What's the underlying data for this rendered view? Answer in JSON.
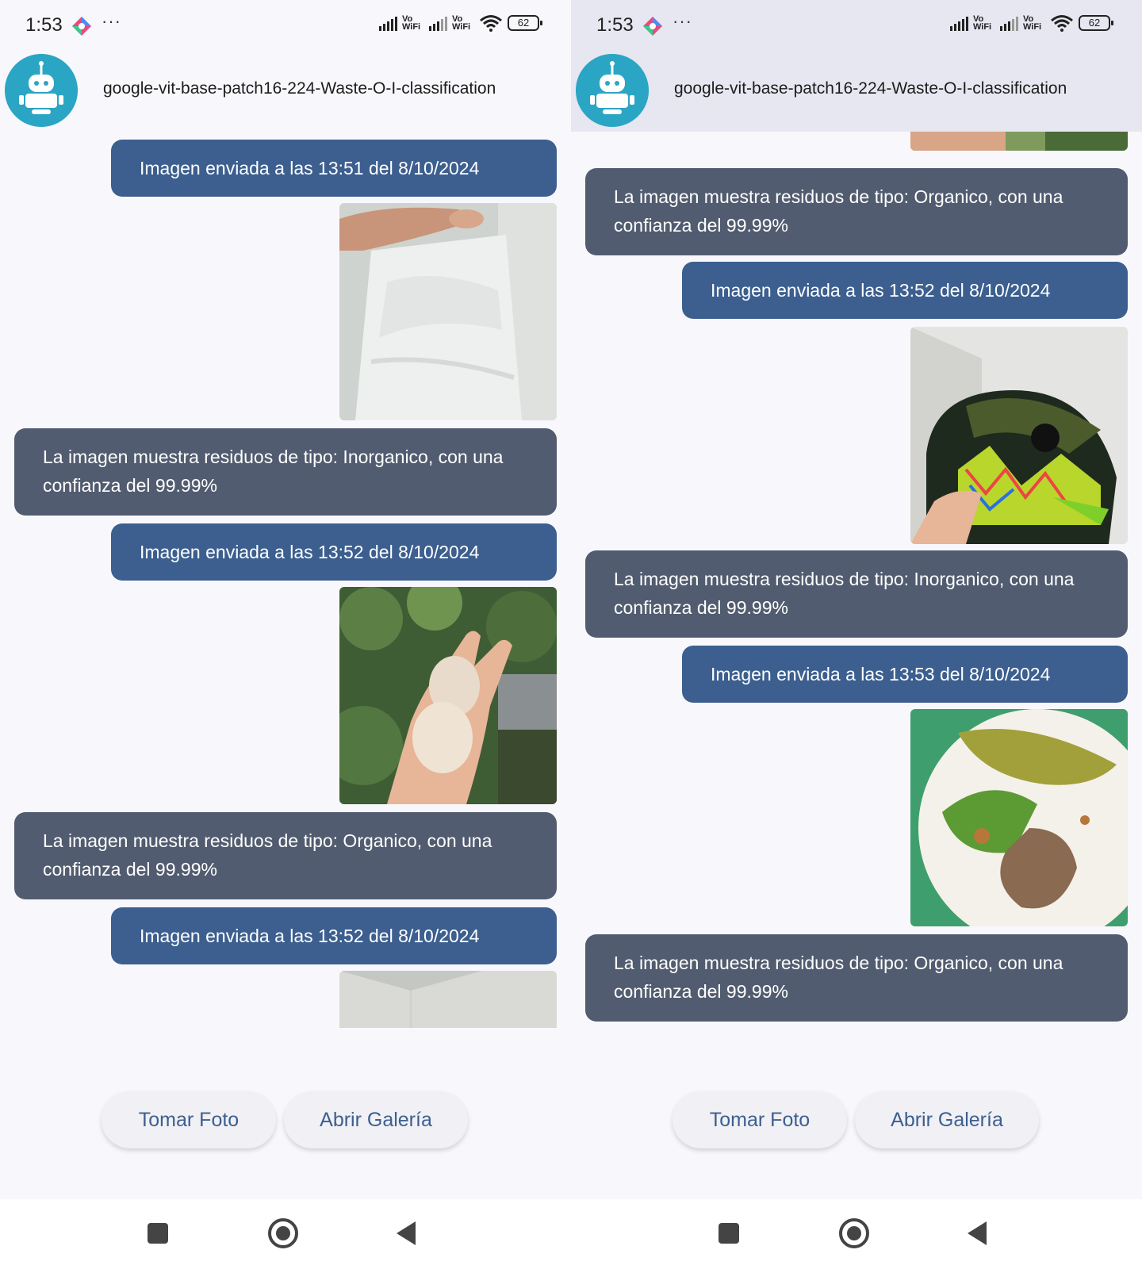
{
  "status_bar": {
    "time": "1:53",
    "more": "···",
    "vowifi": "Vo WiFi",
    "battery": "62"
  },
  "header": {
    "title": "google-vit-base-patch16-224-Waste-O-I-classification"
  },
  "left_screen": {
    "messages": [
      {
        "type": "sent",
        "text": "Imagen enviada a las 13:51 del 8/10/2024"
      },
      {
        "type": "image",
        "subject": "plastic-bag-photo"
      },
      {
        "type": "recv",
        "text": "La imagen muestra residuos de tipo: Inorganico, con una confianza del 99.99%"
      },
      {
        "type": "sent",
        "text": "Imagen enviada a las 13:52 del 8/10/2024"
      },
      {
        "type": "image",
        "subject": "eggs-in-hand-photo"
      },
      {
        "type": "recv",
        "text": "La imagen muestra residuos de tipo: Organico, con una confianza del 99.99%"
      },
      {
        "type": "sent",
        "text": "Imagen enviada a las 13:52 del 8/10/2024"
      },
      {
        "type": "image",
        "subject": "wall-corner-photo-partial"
      }
    ]
  },
  "right_screen": {
    "messages": [
      {
        "type": "image",
        "subject": "eggs-photo-partial"
      },
      {
        "type": "recv",
        "text": "La imagen muestra residuos de tipo: Organico, con una confianza del 99.99%"
      },
      {
        "type": "sent",
        "text": "Imagen enviada a las 13:52 del 8/10/2024"
      },
      {
        "type": "image",
        "subject": "helmet-photo"
      },
      {
        "type": "recv",
        "text": "La imagen muestra residuos de tipo: Inorganico, con una confianza del 99.99%"
      },
      {
        "type": "sent",
        "text": "Imagen enviada a las 13:53 del 8/10/2024"
      },
      {
        "type": "image",
        "subject": "food-scraps-plate-photo"
      },
      {
        "type": "recv",
        "text": "La imagen muestra residuos de tipo: Organico, con una confianza del 99.99%"
      }
    ]
  },
  "actions": {
    "take_photo": "Tomar Foto",
    "open_gallery": "Abrir Galería"
  },
  "colors": {
    "sent_bubble": "#3c5f8f",
    "recv_bubble": "#525c70",
    "avatar": "#2aa6c4"
  }
}
